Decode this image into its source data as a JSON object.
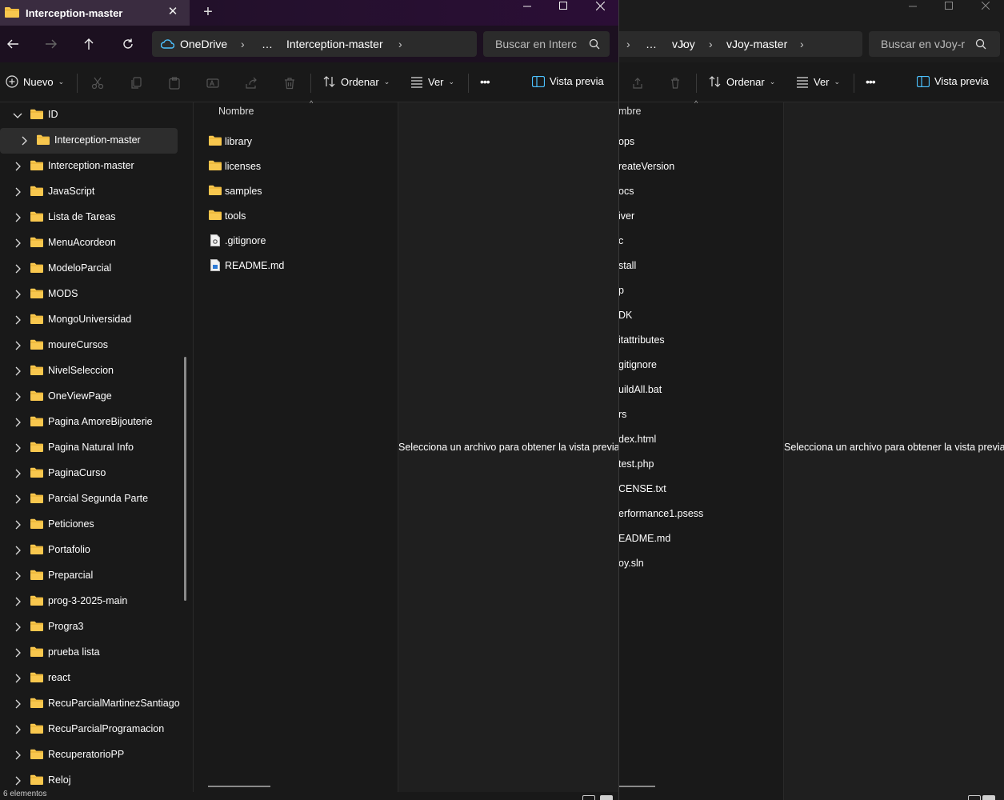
{
  "front": {
    "tab_title": "Interception-master",
    "breadcrumb": [
      "OneDrive",
      "…",
      "Interception-master"
    ],
    "search_placeholder": "Buscar en Interc",
    "toolbar": {
      "new": "Nuevo",
      "sort": "Ordenar",
      "view": "Ver",
      "preview": "Vista previa",
      "more": "•••"
    },
    "tree": [
      "ID",
      "Interception-master",
      "Interception-master",
      "JavaScript",
      "Lista de Tareas",
      "MenuAcordeon",
      "ModeloParcial",
      "MODS",
      "MongoUniversidad",
      "moureCursos",
      "NivelSeleccion",
      "OneViewPage",
      "Pagina AmoreBijouterie",
      "Pagina Natural Info",
      "PaginaCurso",
      "Parcial Segunda Parte",
      "Peticiones",
      "Portafolio",
      "Preparcial",
      "prog-3-2025-main",
      "Progra3",
      "prueba lista",
      "react",
      "RecuParcialMartinezSantiago",
      "RecuParcialProgramacion",
      "RecuperatorioPP",
      "Reloj"
    ],
    "column_name": "Nombre",
    "files": [
      {
        "name": "library",
        "type": "folder"
      },
      {
        "name": "licenses",
        "type": "folder"
      },
      {
        "name": "samples",
        "type": "folder"
      },
      {
        "name": "tools",
        "type": "folder"
      },
      {
        "name": ".gitignore",
        "type": "gear-file"
      },
      {
        "name": "README.md",
        "type": "md-file"
      }
    ],
    "preview_message": "Selecciona un archivo para obtener la vista previa."
  },
  "back": {
    "breadcrumb": [
      "…",
      "vJoy",
      "vJoy-master"
    ],
    "search_placeholder": "Buscar en vJoy-r",
    "toolbar": {
      "sort": "Ordenar",
      "view": "Ver",
      "preview": "Vista previa",
      "more": "•••"
    },
    "column_name": "mbre",
    "files": [
      "ops",
      "reateVersion",
      "ocs",
      "iver",
      "c",
      "stall",
      "p",
      "DK",
      "itattributes",
      "gitignore",
      "uildAll.bat",
      "rs",
      "dex.html",
      "test.php",
      "CENSE.txt",
      "erformance1.psess",
      "EADME.md",
      "oy.sln"
    ],
    "preview_message": "Selecciona un archivo para obtener la vista previa."
  },
  "status_partial": "6 elementos",
  "colors": {
    "folder": "#f8c74e",
    "folder_dark": "#e0a526",
    "accent": "#4cc2ff"
  }
}
